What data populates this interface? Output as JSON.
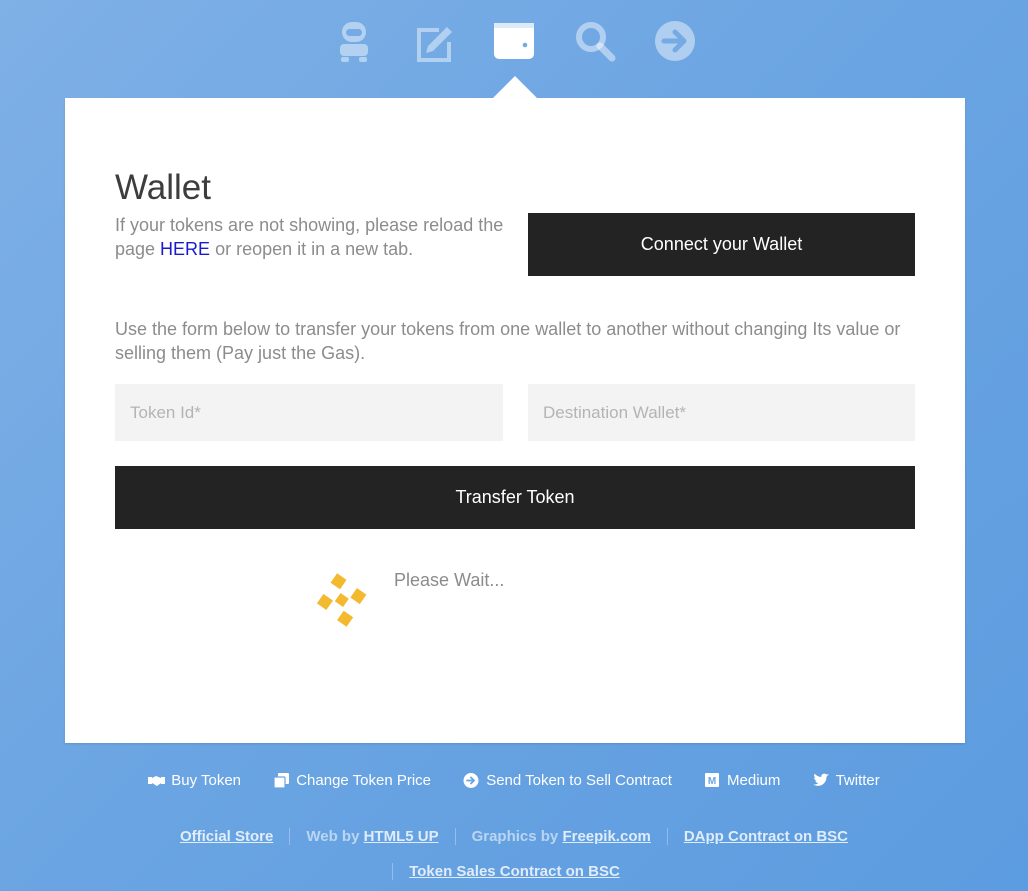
{
  "nav": {
    "icons": [
      "robot-icon",
      "edit-icon",
      "wallet-icon",
      "search-icon",
      "arrow-right-circle-icon"
    ],
    "active": "wallet-icon"
  },
  "wallet": {
    "title": "Wallet",
    "intro_before": "If your tokens are not showing, please reload the page ",
    "intro_link": "HERE",
    "intro_after": " or reopen it in a new tab.",
    "connect_label": "Connect your Wallet",
    "form_description": "Use the form below to transfer your tokens from one wallet to another without changing Its value or selling them (Pay just the Gas).",
    "token_id_placeholder": "Token Id*",
    "destination_placeholder": "Destination Wallet*",
    "transfer_label": "Transfer Token",
    "status_text": "Please Wait..."
  },
  "footer": {
    "links": [
      {
        "label": "Buy Token",
        "icon": "handshake-icon"
      },
      {
        "label": "Change Token Price",
        "icon": "copy-icon"
      },
      {
        "label": "Send Token to Sell Contract",
        "icon": "arrow-circle-right-icon"
      },
      {
        "label": "Medium",
        "icon": "medium-icon"
      },
      {
        "label": "Twitter",
        "icon": "twitter-icon"
      }
    ],
    "credits": {
      "official_store": "Official Store",
      "web_by_prefix": "Web by ",
      "web_by_link": "HTML5 UP",
      "graphics_prefix": "Graphics by ",
      "graphics_link": "Freepik.com",
      "dapp_contract": "DApp Contract on BSC",
      "sales_contract": "Token Sales Contract on BSC"
    }
  },
  "colors": {
    "background": "#6aa4e2",
    "panel": "#ffffff",
    "button": "#232323",
    "link": "#1a1acc",
    "bnb": "#f3ba2f"
  }
}
